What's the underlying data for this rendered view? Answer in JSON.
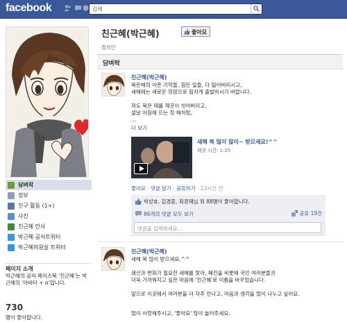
{
  "header": {
    "logo": "facebook",
    "search_value": "검색"
  },
  "page": {
    "name": "친근혜(박근혜)",
    "like_button": "좋아요",
    "category": "정치인",
    "wall_tab": "담벼락"
  },
  "sidebar": {
    "items": [
      {
        "label": "담벼락",
        "icon": "wall-icon",
        "color": "#6d9b3a"
      },
      {
        "label": "정보",
        "icon": "info-icon",
        "color": "#8a9cc2"
      },
      {
        "label": "친구 활동 (1+)",
        "icon": "friends-icon",
        "color": "#5b74a8"
      },
      {
        "label": "사진",
        "icon": "photo-icon",
        "color": "#5a8fd0"
      },
      {
        "label": "친근혜 인사",
        "icon": "greeting-icon",
        "color": "#3f8a3f"
      },
      {
        "label": "박근혜 공식트위터",
        "icon": "twitter-icon",
        "color": "#2f9ad8"
      },
      {
        "label": "박근혜의원실 트위터",
        "icon": "twitter-icon",
        "color": "#2f9ad8"
      }
    ],
    "section_title": "페이지 소개",
    "about": "박근혜의 공식 페이스북 '친근혜'는 박근혜의 '아바타 + α'입니다.",
    "likes_count": "730",
    "likes_label": "명이 좋아합니다."
  },
  "post1": {
    "author": "친근혜(박근혜)",
    "line1": "묵은해의 아픈 기억들, 힘든 일들, 다 털어버리시고,",
    "line2": "새해에는 새로운 희망으로 힘차게 출발하시기 바랍니다.",
    "line3": "저도 묵은 때를 깨끗이 씻어버리고,",
    "line4": "설날 아침에 뜨는 첫 해처럼,",
    "line5": "...",
    "more": "더 보기",
    "video_title": "새해 복 많이 많이~ 받으세요!^^",
    "video_meta": "재생 시간: 1:35",
    "actions": "좋아요 · 댓글 달기 · 공유하기 ·",
    "timestamp": "13시간 전",
    "likes_text": "박상호, 김경훈, 최광재님 외 88명이 좋아합니다.",
    "comments_text": "86개의 댓글 모두 보기",
    "shares_text": "공유 19건",
    "comment_placeholder": "댓글을 입력하세요..."
  },
  "post2": {
    "author": "친근혜(박근혜)",
    "line1": "새해 복 많이 받으세요.^^",
    "line2": "쇄신과 변화가 필요한 새해를 맞아, 폐친을 비롯해 국민 여러분들과",
    "line3": "더욱 가까워지고 싶은 마음에 '친근혜'로 이름을 바꾸었습니다.",
    "line4": "앞으로 이곳에서 여러분을 더 자주 만나고, 마음과 생각을 많이 나누고 싶어요.",
    "line5": "많이 사랑해주시고, '좋아요' 많이 눌러주세요."
  },
  "colors": {
    "brand": "#3b5998",
    "link": "#3b5998"
  }
}
